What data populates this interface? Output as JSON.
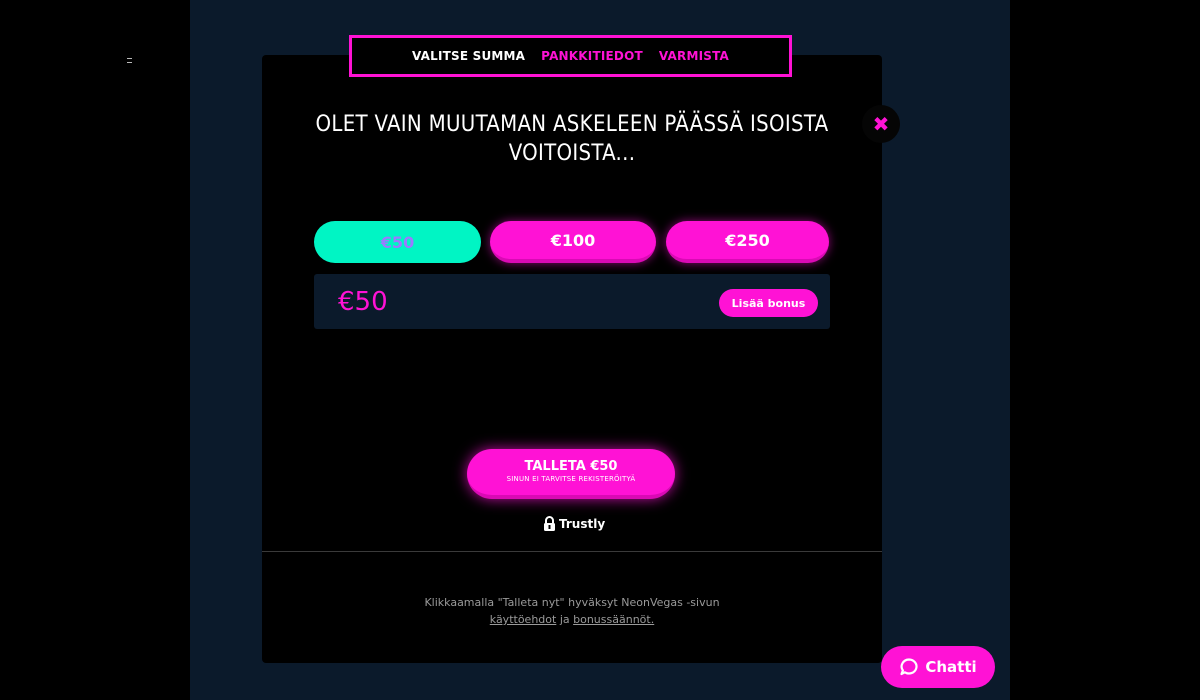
{
  "steps": {
    "active": "VALITSE SUMMA",
    "bank_details": "PANKKITIEDOT",
    "confirm": "VARMISTA"
  },
  "close_glyph": "✖",
  "headline": {
    "line1": "OLET VAIN MUUTAMAN ASKELEEN PÄÄSSÄ ISOISTA",
    "line2": "VOITOISTA..."
  },
  "amount_options": [
    {
      "label": "€50",
      "selected": true
    },
    {
      "label": "€100",
      "selected": false
    },
    {
      "label": "€250",
      "selected": false
    }
  ],
  "amount_input": {
    "value": "€50",
    "bonus_button": "Lisää bonus"
  },
  "deposit": {
    "label": "TALLETA €50",
    "sublabel": "SINUN EI TARVITSE REKISTERÖITYÄ"
  },
  "payment_provider": "Trustly",
  "terms": {
    "text": "Klikkaamalla \"Talleta nyt\" hyväksyt NeonVegas -sivun",
    "link_terms": "käyttöehdot",
    "conjunction": "ja",
    "link_bonus": "bonussäännöt."
  },
  "chat": {
    "label": "Chatti"
  },
  "colors": {
    "accent": "#ff12d5",
    "selected": "#00f5c4",
    "panel": "#0b1a2b",
    "background": "#000000"
  },
  "icons": [
    "close-icon",
    "trustly-lock-icon",
    "chat-bubble-icon"
  ]
}
